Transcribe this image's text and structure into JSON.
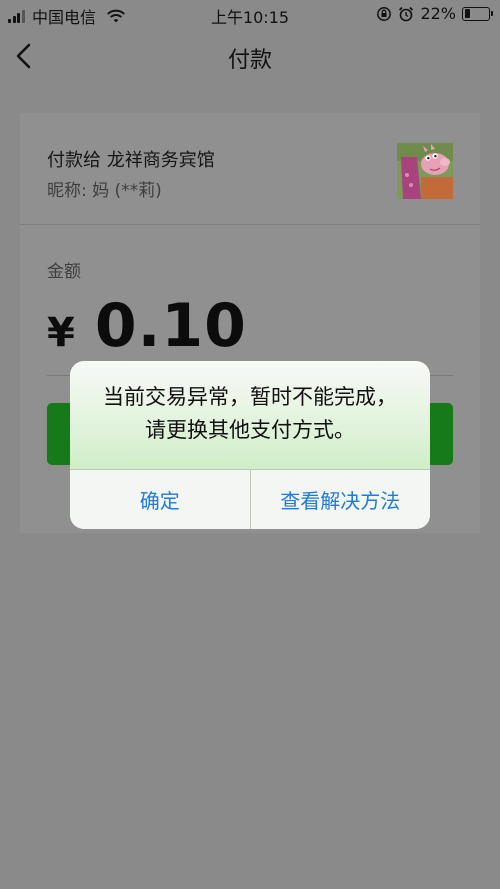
{
  "status_bar": {
    "carrier": "中国电信",
    "time": "上午10:15",
    "battery": "22%"
  },
  "nav": {
    "title": "付款"
  },
  "payee": {
    "name": "付款给 龙祥商务宾馆",
    "nickname": "昵称: 妈 (**莉)"
  },
  "amount": {
    "label": "金额",
    "currency": "¥",
    "value": "0.10"
  },
  "alert": {
    "message": "当前交易异常，暂时不能完成，请更换其他支付方式。",
    "confirm_label": "确定",
    "solution_label": "查看解决方法"
  },
  "colors": {
    "primary_button": "#157a17",
    "alert_link": "#1f7ad8"
  },
  "icons": [
    "signal-icon",
    "wifi-icon",
    "rotation-lock-icon",
    "alarm-icon",
    "battery-icon",
    "back-icon",
    "avatar-image"
  ]
}
